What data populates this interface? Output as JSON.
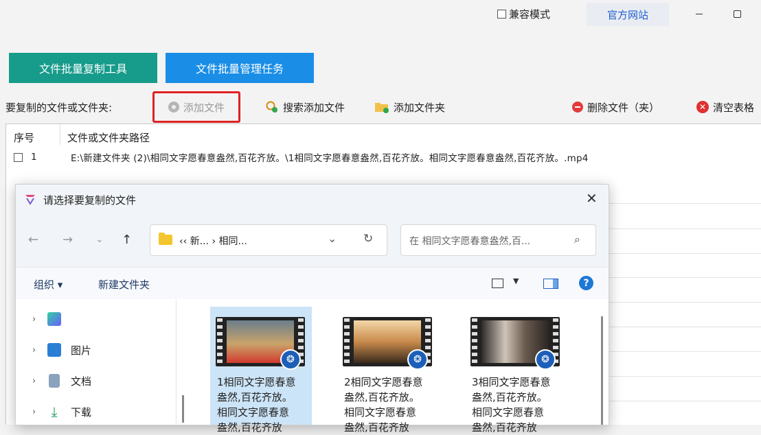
{
  "titlebar": {
    "compat_label": "兼容模式",
    "official_label": "官方网站"
  },
  "tabs": {
    "batch_copy": "文件批量复制工具",
    "batch_manage": "文件批量管理任务"
  },
  "toolbar": {
    "label": "要复制的文件或文件夹:",
    "add_file": "添加文件",
    "search_add": "搜索添加文件",
    "add_folder": "添加文件夹",
    "delete": "删除文件（夹）",
    "clear": "清空表格"
  },
  "table": {
    "col_index": "序号",
    "col_path": "文件或文件夹路径",
    "rows": [
      {
        "index": "1",
        "path": "E:\\新建文件夹 (2)\\相同文字愿春意盎然,百花齐放。\\1相同文字愿春意盎然,百花齐放。相同文字愿春意盎然,百花齐放。.mp4"
      }
    ]
  },
  "dialog": {
    "title": "请选择要复制的文件",
    "close": "✕",
    "nav": {
      "back": "←",
      "forward": "→",
      "recent": "⌄",
      "up": "↑"
    },
    "breadcrumb": "‹‹  新...  ›  相同...",
    "search_placeholder": "在 相同文字愿春意盎然,百...",
    "organize": "组织 ▾",
    "new_folder": "新建文件夹",
    "help": "?",
    "nav_items": [
      {
        "label": "",
        "icon": "app-icon"
      },
      {
        "label": "图片",
        "icon": "pictures-icon"
      },
      {
        "label": "文档",
        "icon": "documents-icon"
      },
      {
        "label": "下载",
        "icon": "downloads-icon"
      }
    ],
    "files": [
      {
        "line1": "1相同文字愿春意",
        "line2": "盎然,百花齐放。",
        "line3": "相同文字愿春意",
        "line4": "盎然,百花齐放"
      },
      {
        "line1": "2相同文字愿春意",
        "line2": "盎然,百花齐放。",
        "line3": "相同文字愿春意",
        "line4": "盎然,百花齐放"
      },
      {
        "line1": "3相同文字愿春意",
        "line2": "盎然,百花齐放。",
        "line3": "相同文字愿春意",
        "line4": "盎然,百花齐放"
      }
    ]
  },
  "colors": {
    "tab_teal": "#179b8b",
    "tab_blue": "#1a8ee6",
    "highlight_red": "#e02020",
    "selection": "#cce4f7"
  }
}
